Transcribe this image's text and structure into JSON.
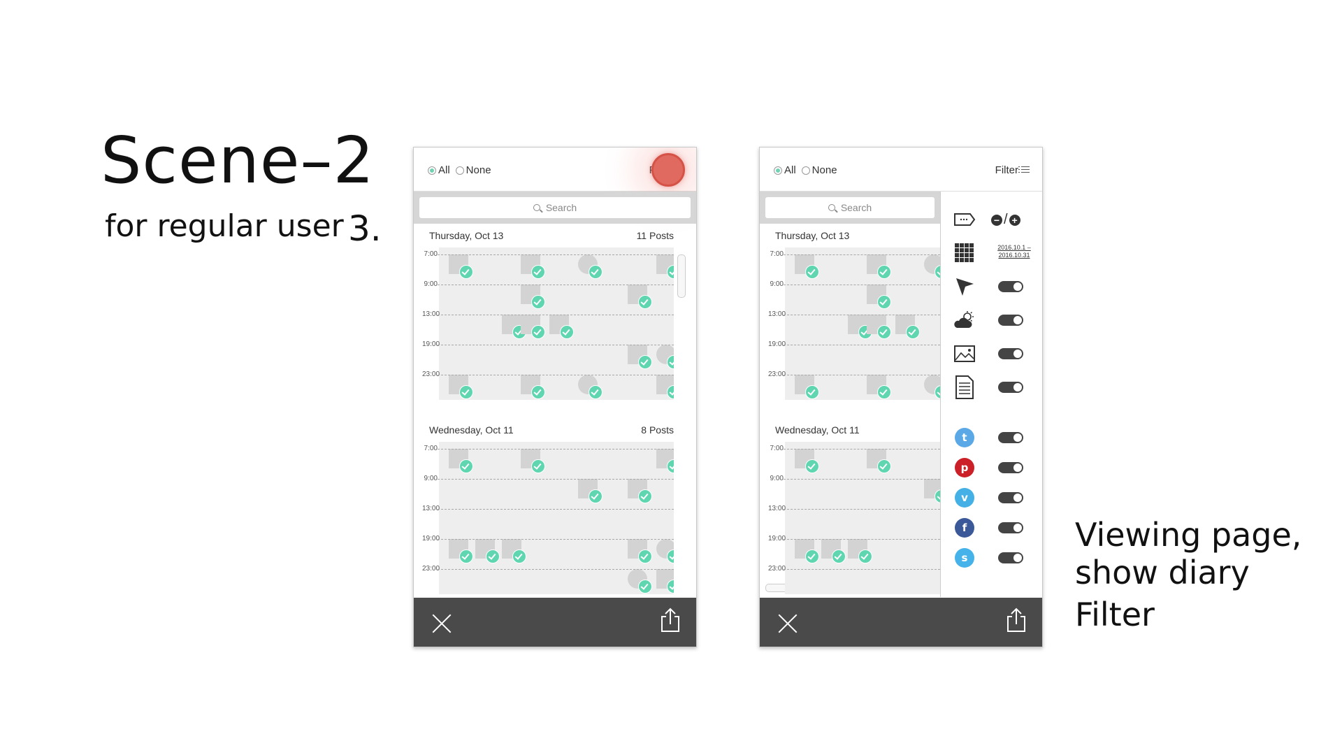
{
  "slide": {
    "title": "Scene–2",
    "subtitle": "for regular user",
    "step": "3.",
    "caption": [
      "Viewing page,",
      "show diary",
      "Filter"
    ]
  },
  "header": {
    "radio_all": "All",
    "radio_none": "None",
    "filter_label": "Filter",
    "selected": "All"
  },
  "search": {
    "placeholder": "Search"
  },
  "hours": [
    "7:00",
    "9:00",
    "13:00",
    "19:00",
    "23:00"
  ],
  "days": [
    {
      "date": "Thursday, Oct 13",
      "count": "11",
      "unit": "Posts"
    },
    {
      "date": "Wednesday, Oct 11",
      "count": "8",
      "unit": "Posts"
    }
  ],
  "filter_panel": {
    "date_range": "2016.10.1 – 2016.10.31",
    "minus_plus_separator": "/",
    "categories": [
      {
        "icon": "tag-icon"
      },
      {
        "icon": "calendar-grid-icon"
      },
      {
        "icon": "location-arrow-icon",
        "enabled": true
      },
      {
        "icon": "weather-icon",
        "enabled": true
      },
      {
        "icon": "image-icon",
        "enabled": true
      },
      {
        "icon": "document-icon",
        "enabled": true
      }
    ],
    "social": [
      {
        "icon": "twitter-icon",
        "glyph": "t",
        "color": "#5aa9e6",
        "enabled": true
      },
      {
        "icon": "pinterest-icon",
        "glyph": "p",
        "color": "#cb2027",
        "enabled": true
      },
      {
        "icon": "vimeo-icon",
        "glyph": "v",
        "color": "#44b0e5",
        "enabled": true
      },
      {
        "icon": "facebook-icon",
        "glyph": "f",
        "color": "#3b5998",
        "enabled": true
      },
      {
        "icon": "skype-icon",
        "glyph": "s",
        "color": "#45b2ea",
        "enabled": true
      }
    ]
  },
  "colors": {
    "check": "#5fd6b0",
    "bottom_bar": "#4a4a4a",
    "touch_indicator": "#e06a5f"
  }
}
